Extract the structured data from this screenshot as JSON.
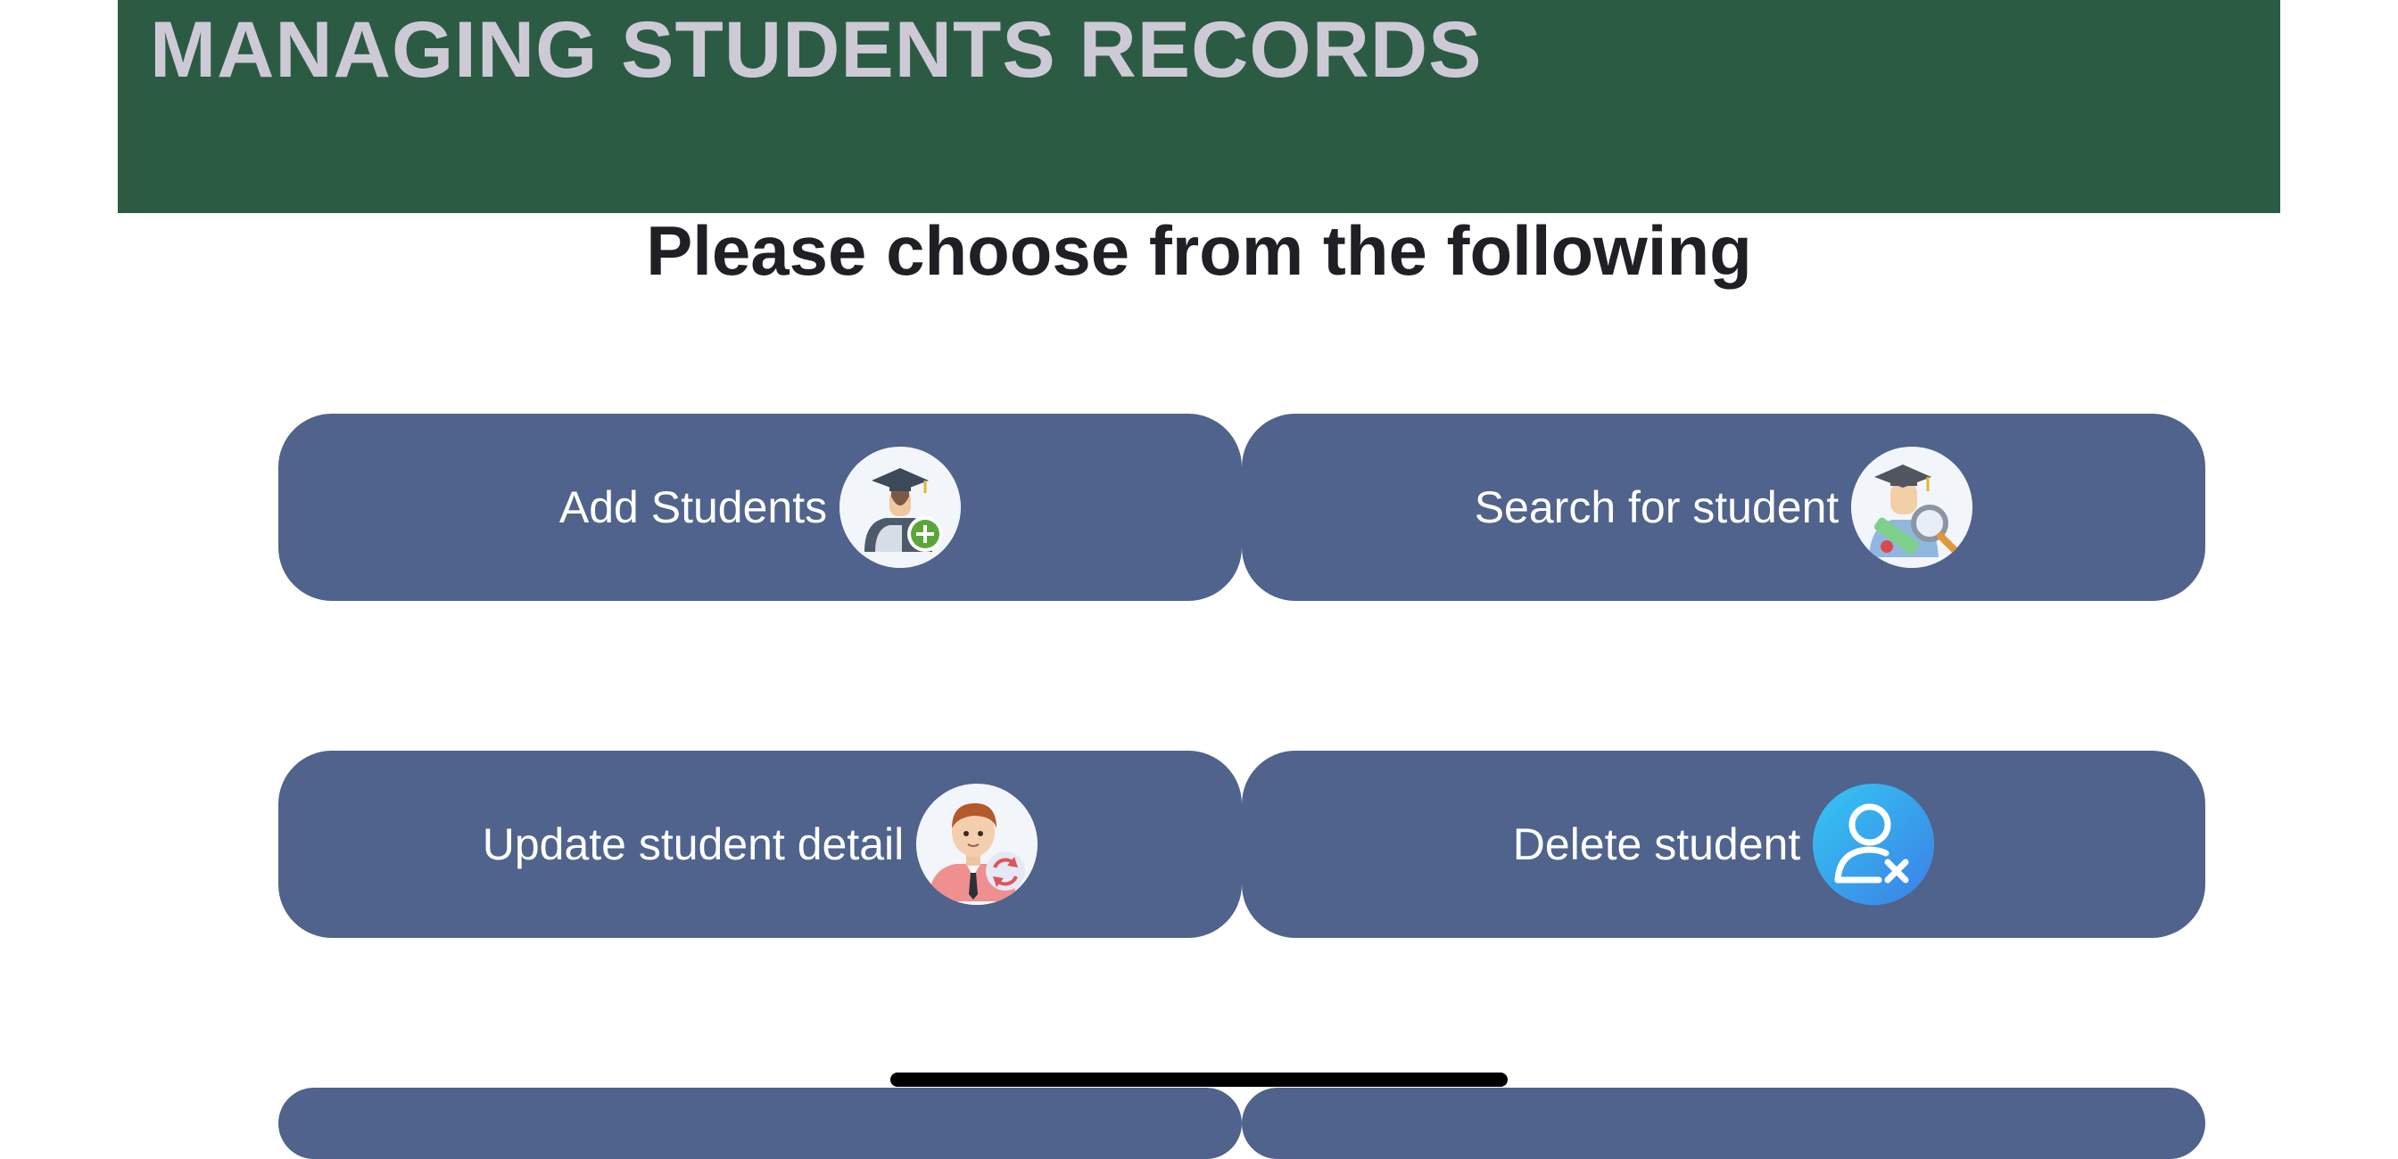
{
  "header": {
    "title": "MANAGING STUDENTS RECORDS",
    "background_color": "#2c5b44",
    "title_color": "#cdcad6"
  },
  "main": {
    "subtitle": "Please choose from the following",
    "tile_color": "#4f638c",
    "options": [
      {
        "label": "Add Students",
        "icon": "graduate-add-icon"
      },
      {
        "label": "Search for student",
        "icon": "graduate-search-icon"
      },
      {
        "label": "Update student detail",
        "icon": "student-refresh-icon"
      },
      {
        "label": "Delete student",
        "icon": "user-remove-icon"
      }
    ]
  }
}
